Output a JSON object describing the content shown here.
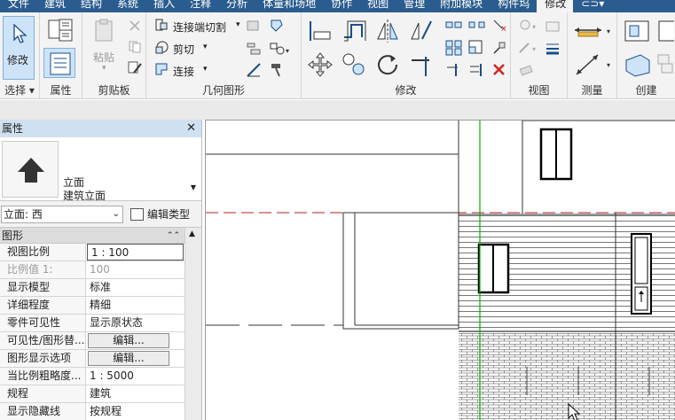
{
  "menubar": {
    "tabs": [
      "文件",
      "建筑",
      "结构",
      "系统",
      "插入",
      "注释",
      "分析",
      "体量和场地",
      "协作",
      "视图",
      "管理",
      "附加模块",
      "构件坞",
      "修改"
    ],
    "active": "修改"
  },
  "ribbon": {
    "select": {
      "modify_label": "修改",
      "panel_label": "选择 ▾"
    },
    "properties": {
      "panel_label": "属性"
    },
    "clipboard": {
      "paste_label": "粘贴",
      "panel_label": "剪贴板"
    },
    "geometry": {
      "join_cut_label": "连接端切割",
      "cut_label": "剪切",
      "join_label": "连接",
      "panel_label": "几何图形"
    },
    "modify": {
      "panel_label": "修改"
    },
    "view": {
      "panel_label": "视图"
    },
    "measure": {
      "panel_label": "测量"
    },
    "create": {
      "panel_label": "创建"
    }
  },
  "properties": {
    "title": "属性",
    "type_line1": "立面",
    "type_line2": "建筑立面",
    "instance_selector": "立面: 西",
    "edit_type_label": "编辑类型",
    "group_graphics": "图形",
    "rows": [
      {
        "name": "视图比例",
        "value": "1 : 100"
      },
      {
        "name": "比例值 1:",
        "value": "100"
      },
      {
        "name": "显示模型",
        "value": "标准"
      },
      {
        "name": "详细程度",
        "value": "精细"
      },
      {
        "name": "零件可见性",
        "value": "显示原状态"
      },
      {
        "name": "可见性/图形替...",
        "value": "编辑..."
      },
      {
        "name": "图形显示选项",
        "value": "编辑..."
      },
      {
        "name": "当比例粗略度...",
        "value": "1 : 5000"
      },
      {
        "name": "规程",
        "value": "建筑"
      },
      {
        "name": "显示隐藏线",
        "value": "按规程"
      }
    ]
  },
  "colors": {
    "menubar_bg": "#2b5c8f",
    "ribbon_bg": "#f3f3f3",
    "palette_title_bg": "#cfe0f0",
    "level_line": "#b22222",
    "reference_line": "#00b000"
  }
}
